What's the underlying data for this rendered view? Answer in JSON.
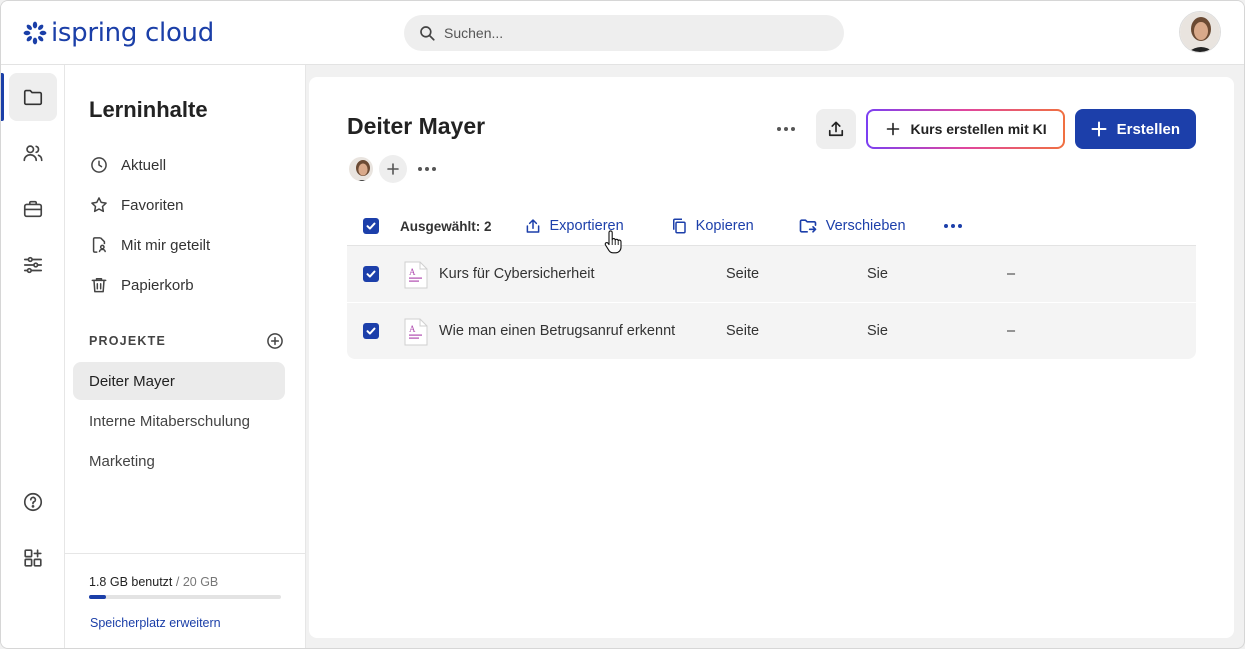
{
  "header": {
    "logo_text": "ispring cloud",
    "search_placeholder": "Suchen...",
    "brand_color": "#1b3fa8"
  },
  "rail": {
    "items": [
      {
        "icon": "folder-icon",
        "active": true
      },
      {
        "icon": "users-icon",
        "active": false
      },
      {
        "icon": "briefcase-icon",
        "active": false
      },
      {
        "icon": "sliders-icon",
        "active": false
      }
    ],
    "bottom_items": [
      {
        "icon": "help-icon"
      },
      {
        "icon": "apps-add-icon"
      }
    ]
  },
  "sidebar": {
    "title": "Lerninhalte",
    "nav": [
      {
        "label": "Aktuell",
        "icon": "clock-icon"
      },
      {
        "label": "Favoriten",
        "icon": "star-icon"
      },
      {
        "label": "Mit mir geteilt",
        "icon": "shared-doc-icon"
      },
      {
        "label": "Papierkorb",
        "icon": "trash-icon"
      }
    ],
    "projects_label": "PROJEKTE",
    "projects": [
      {
        "label": "Deiter Mayer",
        "active": true
      },
      {
        "label": "Interne Mitaberschulung",
        "active": false
      },
      {
        "label": "Marketing",
        "active": false
      }
    ],
    "storage": {
      "used": "1.8 GB benutzt",
      "total": "/ 20 GB",
      "fraction": 0.09,
      "link": "Speicherplatz erweitern"
    }
  },
  "main": {
    "title": "Deiter Mayer",
    "ki_button": "Kurs erstellen mit KI",
    "create_button": "Erstellen",
    "toolbar": {
      "selected": "Ausgewählt: 2",
      "export": "Exportieren",
      "copy": "Kopieren",
      "move": "Verschieben"
    },
    "rows": [
      {
        "name": "Kurs für Cybersicherheit",
        "type": "Seite",
        "owner": "Sie",
        "extra": "–"
      },
      {
        "name": "Wie man einen Betrugsanruf erkennt",
        "type": "Seite",
        "owner": "Sie",
        "extra": "–"
      }
    ]
  }
}
